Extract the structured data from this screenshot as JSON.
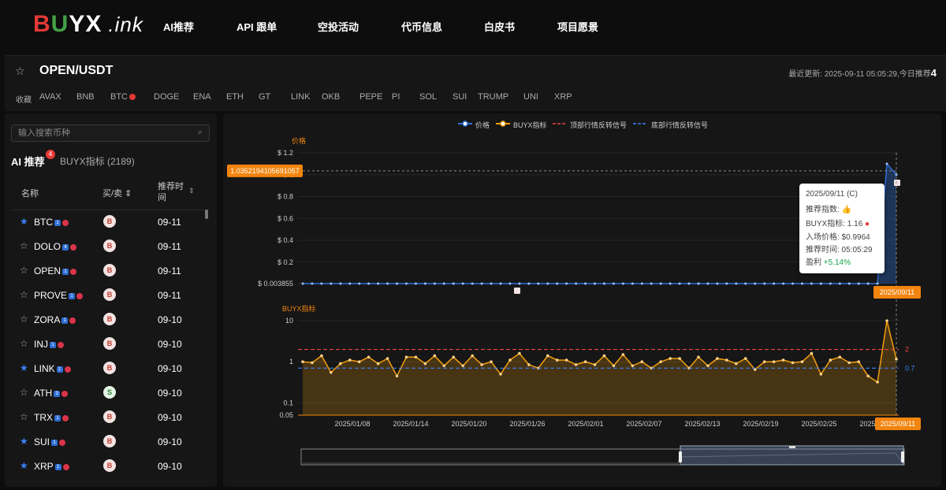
{
  "brand": {
    "b": "B",
    "u": "U",
    "yx": "YX",
    "ink": ".ink"
  },
  "nav": [
    "AI推荐",
    "API 跟单",
    "空投活动",
    "代币信息",
    "白皮书",
    "项目愿景"
  ],
  "pair": {
    "title": "OPEN/USDT",
    "updated_label": "最近更新: 2025-09-11 05:05:29,今日推荐",
    "updated_count": "4"
  },
  "favorites": {
    "label": "收藏",
    "coins": [
      "AVAX",
      "BNB",
      "BTC",
      "DOGE",
      "ENA",
      "ETH",
      "GT",
      "LINK",
      "OKB",
      "PEPE",
      "PI",
      "SOL",
      "SUI",
      "TRUMP",
      "UNI",
      "XRP"
    ]
  },
  "sidebar": {
    "search_placeholder": "输入搜索币种",
    "tab_ai": "AI 推荐",
    "tab_ai_badge": "4",
    "tab_buyx": "BUYX指标 (2189)",
    "col_name": "名称",
    "col_side": "买/卖 ⇕",
    "col_time": "推荐时间",
    "rows": [
      {
        "name": "BTC",
        "mark": "1",
        "starred": true,
        "signal": "B",
        "date": "09-11"
      },
      {
        "name": "DOLO",
        "mark": "4",
        "starred": false,
        "signal": "B",
        "date": "09-11"
      },
      {
        "name": "OPEN",
        "mark": "1",
        "starred": false,
        "signal": "B",
        "date": "09-11"
      },
      {
        "name": "PROVE",
        "mark": "1",
        "starred": false,
        "signal": "B",
        "date": "09-11"
      },
      {
        "name": "ZORA",
        "mark": "1",
        "starred": false,
        "signal": "B",
        "date": "09-10"
      },
      {
        "name": "INJ",
        "mark": "1",
        "starred": false,
        "signal": "B",
        "date": "09-10"
      },
      {
        "name": "LINK",
        "mark": "1",
        "starred": true,
        "signal": "B",
        "date": "09-10"
      },
      {
        "name": "ATH",
        "mark": "3",
        "starred": false,
        "signal": "S",
        "date": "09-10"
      },
      {
        "name": "TRX",
        "mark": "1",
        "starred": false,
        "signal": "B",
        "date": "09-10"
      },
      {
        "name": "SUI",
        "mark": "1",
        "starred": true,
        "signal": "B",
        "date": "09-10"
      },
      {
        "name": "XRP",
        "mark": "1",
        "starred": true,
        "signal": "B",
        "date": "09-10"
      }
    ]
  },
  "legend": {
    "price": "价格",
    "buyx": "BUYX指标",
    "top": "顶部行情反转信号",
    "bottom": "底部行情反转信号"
  },
  "tooltip": {
    "date": "2025/09/11 (C)",
    "index_label": "推荐指数:",
    "buyx_label": "BUYX指标: 1.16",
    "entry": "入场价格: $0.9964",
    "time": "推荐时间: 05:05:29",
    "profit_label": "盈利",
    "profit_value": "+5.14%"
  },
  "colors": {
    "price": "#2f6fd6",
    "buyx": "#f59e0b",
    "top_signal": "#ef4444",
    "bottom_signal": "#3b82f6",
    "accent": "#f2850f"
  },
  "chart_data": [
    {
      "type": "line",
      "title": "价格",
      "y_ticks": [
        "$ 1.2",
        "$ 1",
        "$ 0.8",
        "$ 0.6",
        "$ 0.4",
        "$ 0.2",
        "$ 0.003855"
      ],
      "crosshair_value": "1.0352194105691057",
      "crosshair_date": "2025/09/11",
      "ylim": [
        0.003855,
        1.2
      ],
      "series": [
        {
          "name": "价格",
          "values": [
            0.003855,
            0.003855,
            0.003855,
            0.003855,
            0.003855,
            0.003855,
            0.003855,
            0.003855,
            0.003855,
            0.003855,
            0.003855,
            0.003855,
            0.003855,
            0.003855,
            0.003855,
            0.003855,
            0.003855,
            0.003855,
            0.003855,
            0.003855,
            0.003855,
            0.003855,
            0.003855,
            0.003855,
            0.003855,
            0.003855,
            0.003855,
            0.003855,
            0.003855,
            0.003855,
            0.003855,
            0.003855,
            0.003855,
            0.003855,
            0.003855,
            0.003855,
            0.003855,
            0.003855,
            0.003855,
            0.003855,
            0.003855,
            0.003855,
            0.003855,
            0.003855,
            0.003855,
            0.003855,
            0.003855,
            0.003855,
            0.003855,
            0.003855,
            0.003855,
            0.003855,
            0.003855,
            0.003855,
            0.003855,
            0.003855,
            0.003855,
            0.003855,
            0.003855,
            0.003855,
            0.003855,
            0.003855,
            1.1,
            1.0
          ]
        }
      ]
    },
    {
      "type": "line",
      "title": "BUYX指标",
      "scale": "log",
      "y_ticks": [
        "10",
        "1",
        "0.1",
        "0.05"
      ],
      "signal_lines": [
        {
          "name": "顶部行情反转信号",
          "value": 2,
          "label": "2"
        },
        {
          "name": "底部行情反转信号",
          "value": 0.7,
          "label": "0.7"
        }
      ],
      "ylim": [
        0.05,
        12
      ],
      "x_ticks": [
        "2025/01/08",
        "2025/01/14",
        "2025/01/20",
        "2025/01/26",
        "2025/02/01",
        "2025/02/07",
        "2025/02/13",
        "2025/02/19",
        "2025/02/25",
        "2025/03/03"
      ],
      "crosshair_date": "2025/09/11",
      "series": [
        {
          "name": "BUYX指标",
          "values": [
            1.0,
            0.95,
            1.4,
            0.55,
            0.9,
            1.1,
            1.0,
            1.3,
            0.9,
            1.2,
            0.45,
            1.3,
            1.3,
            0.9,
            1.4,
            0.8,
            1.3,
            0.8,
            1.4,
            0.85,
            1.0,
            0.5,
            1.1,
            1.6,
            0.85,
            0.7,
            1.4,
            1.1,
            1.1,
            0.85,
            1.0,
            0.85,
            1.4,
            0.8,
            1.5,
            0.8,
            1.0,
            0.7,
            1.0,
            1.2,
            1.2,
            0.7,
            1.3,
            0.8,
            1.2,
            1.1,
            0.9,
            1.2,
            0.65,
            1.0,
            1.0,
            1.1,
            0.95,
            1.0,
            1.6,
            0.5,
            1.1,
            1.3,
            0.95,
            1.0,
            0.45,
            0.32,
            10,
            1.16
          ]
        }
      ]
    }
  ]
}
